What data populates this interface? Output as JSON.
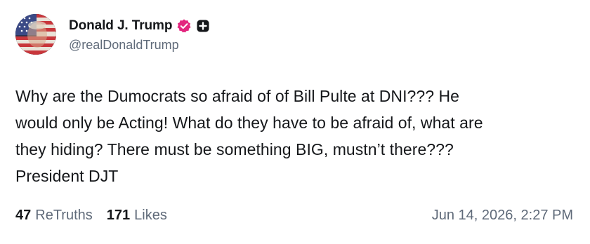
{
  "author": {
    "display_name": "Donald J. Trump",
    "handle": "@realDonaldTrump",
    "avatar_icon": "avatar-portrait-flag",
    "verified_icon": "verified-badge-icon",
    "verified_color": "#e3257e",
    "extra_icon": "plus-square-icon"
  },
  "post": {
    "text": "Why are the Dumocrats so afraid of of Bill Pulte at DNI??? He\nwould only be Acting! What do they have to be afraid of, what are\nthey hiding? There must be something BIG, mustn’t there???\nPresident DJT"
  },
  "stats": {
    "retruths_count": "47",
    "retruths_label": "ReTruths",
    "likes_count": "171",
    "likes_label": "Likes"
  },
  "timestamp": "Jun 14, 2026, 2:27 PM",
  "colors": {
    "text": "#15171a",
    "muted": "#5f6a79",
    "background": "#ffffff"
  }
}
